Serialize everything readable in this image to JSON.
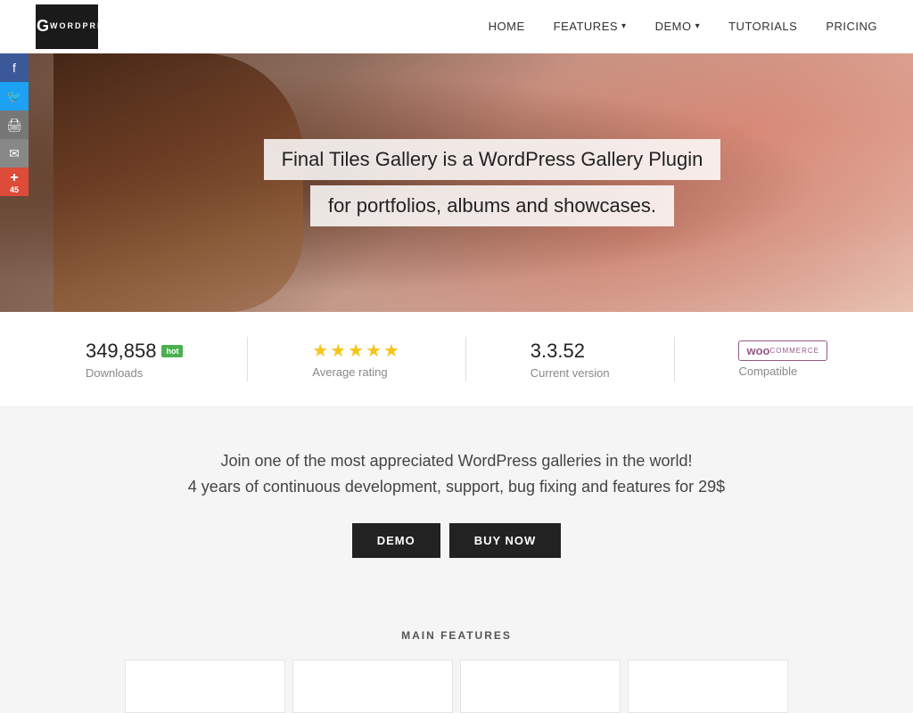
{
  "header": {
    "logo": {
      "line1": "FTG",
      "line2": "WORDPRESS"
    },
    "nav": {
      "home": "HOME",
      "features": "FEATURES",
      "demo": "DEMO",
      "tutorials": "TUTORIALS",
      "pricing": "PRICING"
    }
  },
  "social": {
    "facebook_label": "f",
    "twitter_label": "t",
    "print_label": "🖨",
    "email_label": "✉",
    "plus_label": "+",
    "plus_count": "45"
  },
  "hero": {
    "line1": "Final Tiles Gallery is a WordPress Gallery Plugin",
    "line2": "for portfolios, albums and showcases."
  },
  "stats": {
    "downloads_value": "349,858",
    "downloads_hot": "hot",
    "downloads_label": "Downloads",
    "rating_stars": "★★★★★",
    "rating_label": "Average rating",
    "version_value": "3.3.52",
    "version_label": "Current version",
    "woo_label": "WooCommerce",
    "woo_compatible": "Compatible"
  },
  "promo": {
    "line1": "Join one of the most appreciated WordPress galleries in the world!",
    "line2": "4 years of continuous development, support, bug fixing and features for 29$",
    "demo_btn": "DEMO",
    "buy_btn": "BUY NOW"
  },
  "features": {
    "title": "MAIN FEATURES"
  }
}
